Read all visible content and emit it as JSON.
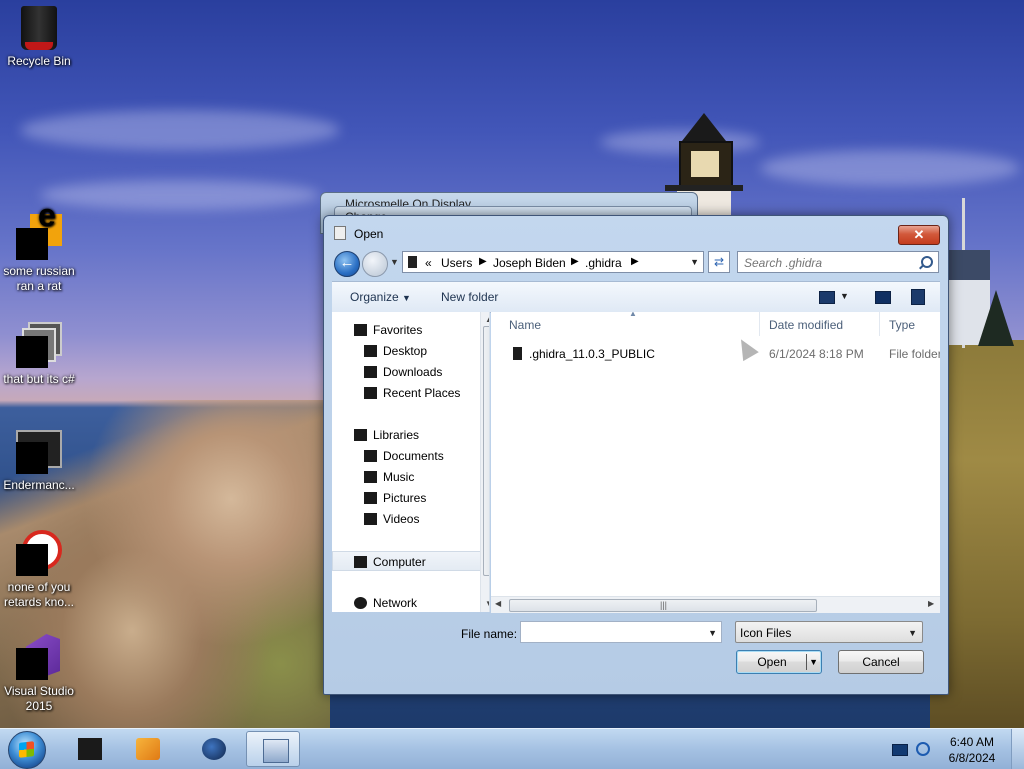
{
  "desktop": {
    "icons": [
      {
        "label": "Recycle Bin"
      },
      {
        "label": "some russian ran a rat"
      },
      {
        "label": "that but its c#"
      },
      {
        "label": "Endermanc..."
      },
      {
        "label": "none of you retards kno..."
      },
      {
        "label": "Visual Studio 2015"
      }
    ]
  },
  "background_windows": {
    "window1_title": "Microsmelle On Display",
    "window2_title": "Change..."
  },
  "dialog": {
    "title": "Open",
    "close_glyph": "✕",
    "address": {
      "overflow": "«",
      "crumbs": [
        "Users",
        "Joseph Biden",
        ".ghidra"
      ]
    },
    "search_placeholder": "Search .ghidra",
    "toolbar": {
      "organize": "Organize",
      "new_folder": "New folder"
    },
    "nav": {
      "favorites": "Favorites",
      "desktop": "Desktop",
      "downloads": "Downloads",
      "recent_places": "Recent Places",
      "libraries": "Libraries",
      "documents": "Documents",
      "music": "Music",
      "pictures": "Pictures",
      "videos": "Videos",
      "computer": "Computer",
      "network": "Network"
    },
    "columns": {
      "name": "Name",
      "date_modified": "Date modified",
      "type": "Type"
    },
    "files": [
      {
        "name": ".ghidra_11.0.3_PUBLIC",
        "date": "6/1/2024 8:18 PM",
        "type": "File folder"
      }
    ],
    "file_name_label": "File name:",
    "file_name_value": "",
    "file_type": "Icon Files",
    "open_button": "Open",
    "cancel_button": "Cancel"
  },
  "taskbar": {
    "time": "6:40 AM",
    "date": "6/8/2024"
  }
}
